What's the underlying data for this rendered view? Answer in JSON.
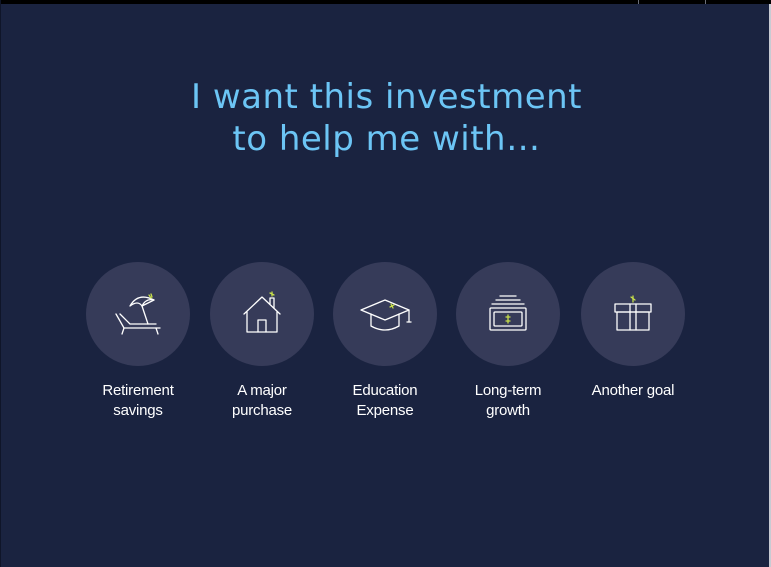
{
  "heading": {
    "line1": "I want this investment",
    "line2": "to help me with…"
  },
  "goals": [
    {
      "icon": "beach-umbrella-icon",
      "label_line1": "Retirement",
      "label_line2": "savings"
    },
    {
      "icon": "house-icon",
      "label_line1": "A major",
      "label_line2": "purchase"
    },
    {
      "icon": "graduation-cap-icon",
      "label_line1": "Education",
      "label_line2": "Expense"
    },
    {
      "icon": "money-stack-icon",
      "label_line1": "Long-term",
      "label_line2": "growth"
    },
    {
      "icon": "gift-icon",
      "label_line1": "Another goal",
      "label_line2": ""
    }
  ],
  "colors": {
    "background": "#1a2340",
    "heading": "#6cc5f5",
    "icon_circle": "#363b59",
    "icon_stroke": "#ffffff",
    "accent": "#c8e04a"
  }
}
